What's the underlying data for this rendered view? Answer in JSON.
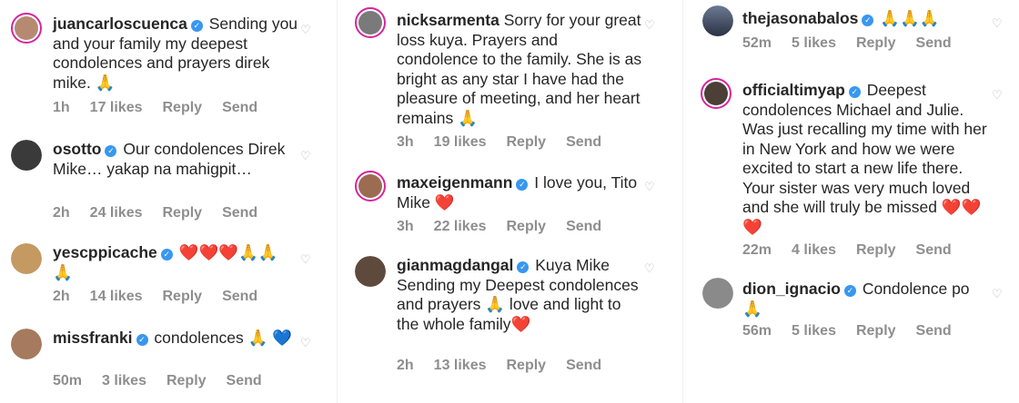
{
  "columns": [
    {
      "comments": [
        {
          "user": "juancarloscuenca",
          "text": "Sending you and your family my deepest condolences and prayers direk mike. 🙏",
          "time": "1h",
          "likes": "17 likes",
          "reply": "Reply",
          "send": "Send"
        },
        {
          "user": "osotto",
          "text": "Our condolences Direk Mike… yakap na mahigpit…",
          "time": "2h",
          "likes": "24 likes",
          "reply": "Reply",
          "send": "Send"
        },
        {
          "user": "yescppicache",
          "text": "❤️❤️❤️🙏🙏 🙏",
          "time": "2h",
          "likes": "14 likes",
          "reply": "Reply",
          "send": "Send"
        },
        {
          "user": "missfranki",
          "text": "condolences 🙏 💙",
          "time": "50m",
          "likes": "3 likes",
          "reply": "Reply",
          "send": "Send"
        }
      ]
    },
    {
      "comments": [
        {
          "user": "nicksarmenta",
          "text": "Sorry for your great loss kuya. Prayers and condolence to the family. She is as bright as any star I have had the pleasure of meeting, and her heart remains 🙏",
          "time": "3h",
          "likes": "19 likes",
          "reply": "Reply",
          "send": "Send"
        },
        {
          "user": "maxeigenmann",
          "text": "I love you, Tito Mike ❤️",
          "time": "3h",
          "likes": "22 likes",
          "reply": "Reply",
          "send": "Send"
        },
        {
          "user": "gianmagdangal",
          "text": "Kuya Mike Sending my Deepest condolences and prayers 🙏 love and light to the whole family❤️",
          "time": "2h",
          "likes": "13 likes",
          "reply": "Reply",
          "send": "Send"
        }
      ]
    },
    {
      "comments": [
        {
          "user": "thejasonabalos",
          "text": "🙏🙏🙏",
          "time": "52m",
          "likes": "5 likes",
          "reply": "Reply",
          "send": "Send"
        },
        {
          "user": "officialtimyap",
          "text": "Deepest condolences Michael and Julie. Was just recalling my time with her in New York and how we were excited to start a new life there. Your sister was very much loved and she will truly be missed ❤️❤️❤️",
          "time": "22m",
          "likes": "4 likes",
          "reply": "Reply",
          "send": "Send"
        },
        {
          "user": "dion_ignacio",
          "text": "Condolence po 🙏",
          "time": "56m",
          "likes": "5 likes",
          "reply": "Reply",
          "send": "Send"
        }
      ]
    }
  ],
  "colors": {
    "verified": "#3897f0",
    "meta": "#8e8e8e",
    "ring": "#d6249f"
  },
  "icons": {
    "verified": "verified-badge-icon",
    "like": "heart-outline-icon"
  }
}
